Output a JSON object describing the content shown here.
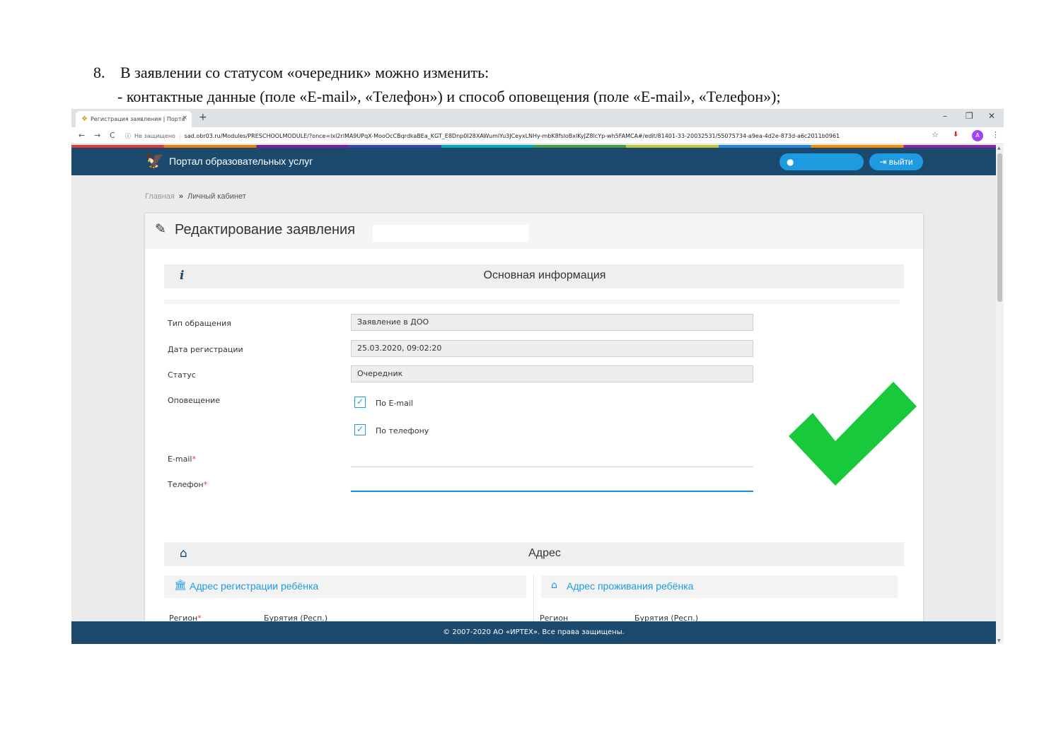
{
  "document": {
    "item_number": "8.",
    "line1": "В заявлении со статусом «очередник» можно изменить:",
    "line2": "- контактные данные (поле «E-mail», «Телефон») и способ оповещения (поле «E-mail», «Телефон»);"
  },
  "browser": {
    "tab_title": "Регистрация заявления | Порта",
    "tab_close": "×",
    "new_tab": "+",
    "window_controls": {
      "minimize": "–",
      "restore": "❐",
      "close": "✕"
    },
    "nav": {
      "back": "←",
      "forward": "→",
      "reload": "C",
      "info": "ⓘ"
    },
    "security_text": "Не защищено",
    "url_separator": "|",
    "url": "sad.obr03.ru/Modules/PRESCHOOLMODULE/?once=lxl2riMA9UPqX-MooOcCBqrdkaBEa_KGT_E8Dnp0I28XAWumlYu3JCeyxLNHy-mbK8fsloBxlKyJZ8lcYp-wh5FAMCA#/edit/81401-33-20032531/55075734-a9ea-4d2e-873d-a6c2011b0961",
    "star": "☆",
    "extension": "⬇",
    "avatar_letter": "A",
    "menu": "⋮"
  },
  "site": {
    "title": "Портал образовательных услуг",
    "user_icon": "●",
    "logout_label": "выйти"
  },
  "breadcrumb": {
    "home": "Главная",
    "separator": "»",
    "current": "Личный кабинет"
  },
  "form": {
    "title": "Редактирование заявления",
    "main_section": "Основная информация",
    "info_icon": "i",
    "fields": {
      "type_label": "Тип обращения",
      "type_value": "Заявление в ДОО",
      "date_label": "Дата регистрации",
      "date_value": "25.03.2020, 09:02:20",
      "status_label": "Статус",
      "status_value": "Очередник",
      "notify_label": "Оповещение",
      "notify_email": "По E-mail",
      "notify_phone": "По телефону",
      "check_glyph": "✓",
      "email_label": "E-mail",
      "phone_label": "Телефон",
      "required_mark": "*"
    },
    "address_section": "Адрес",
    "address_reg": "Адрес регистрации ребёнка",
    "address_live": "Адрес проживания ребёнка",
    "region_label": "Регион",
    "region_value": "Бурятия (Респ.)"
  },
  "footer": {
    "copyright": "© 2007-2020 АО «ИРТЕХ». Все права защищены."
  },
  "colors": {
    "header": "#1c4a6e",
    "accent": "#1e9ae0",
    "check_mark": "#19c93c",
    "required": "#e53935"
  }
}
